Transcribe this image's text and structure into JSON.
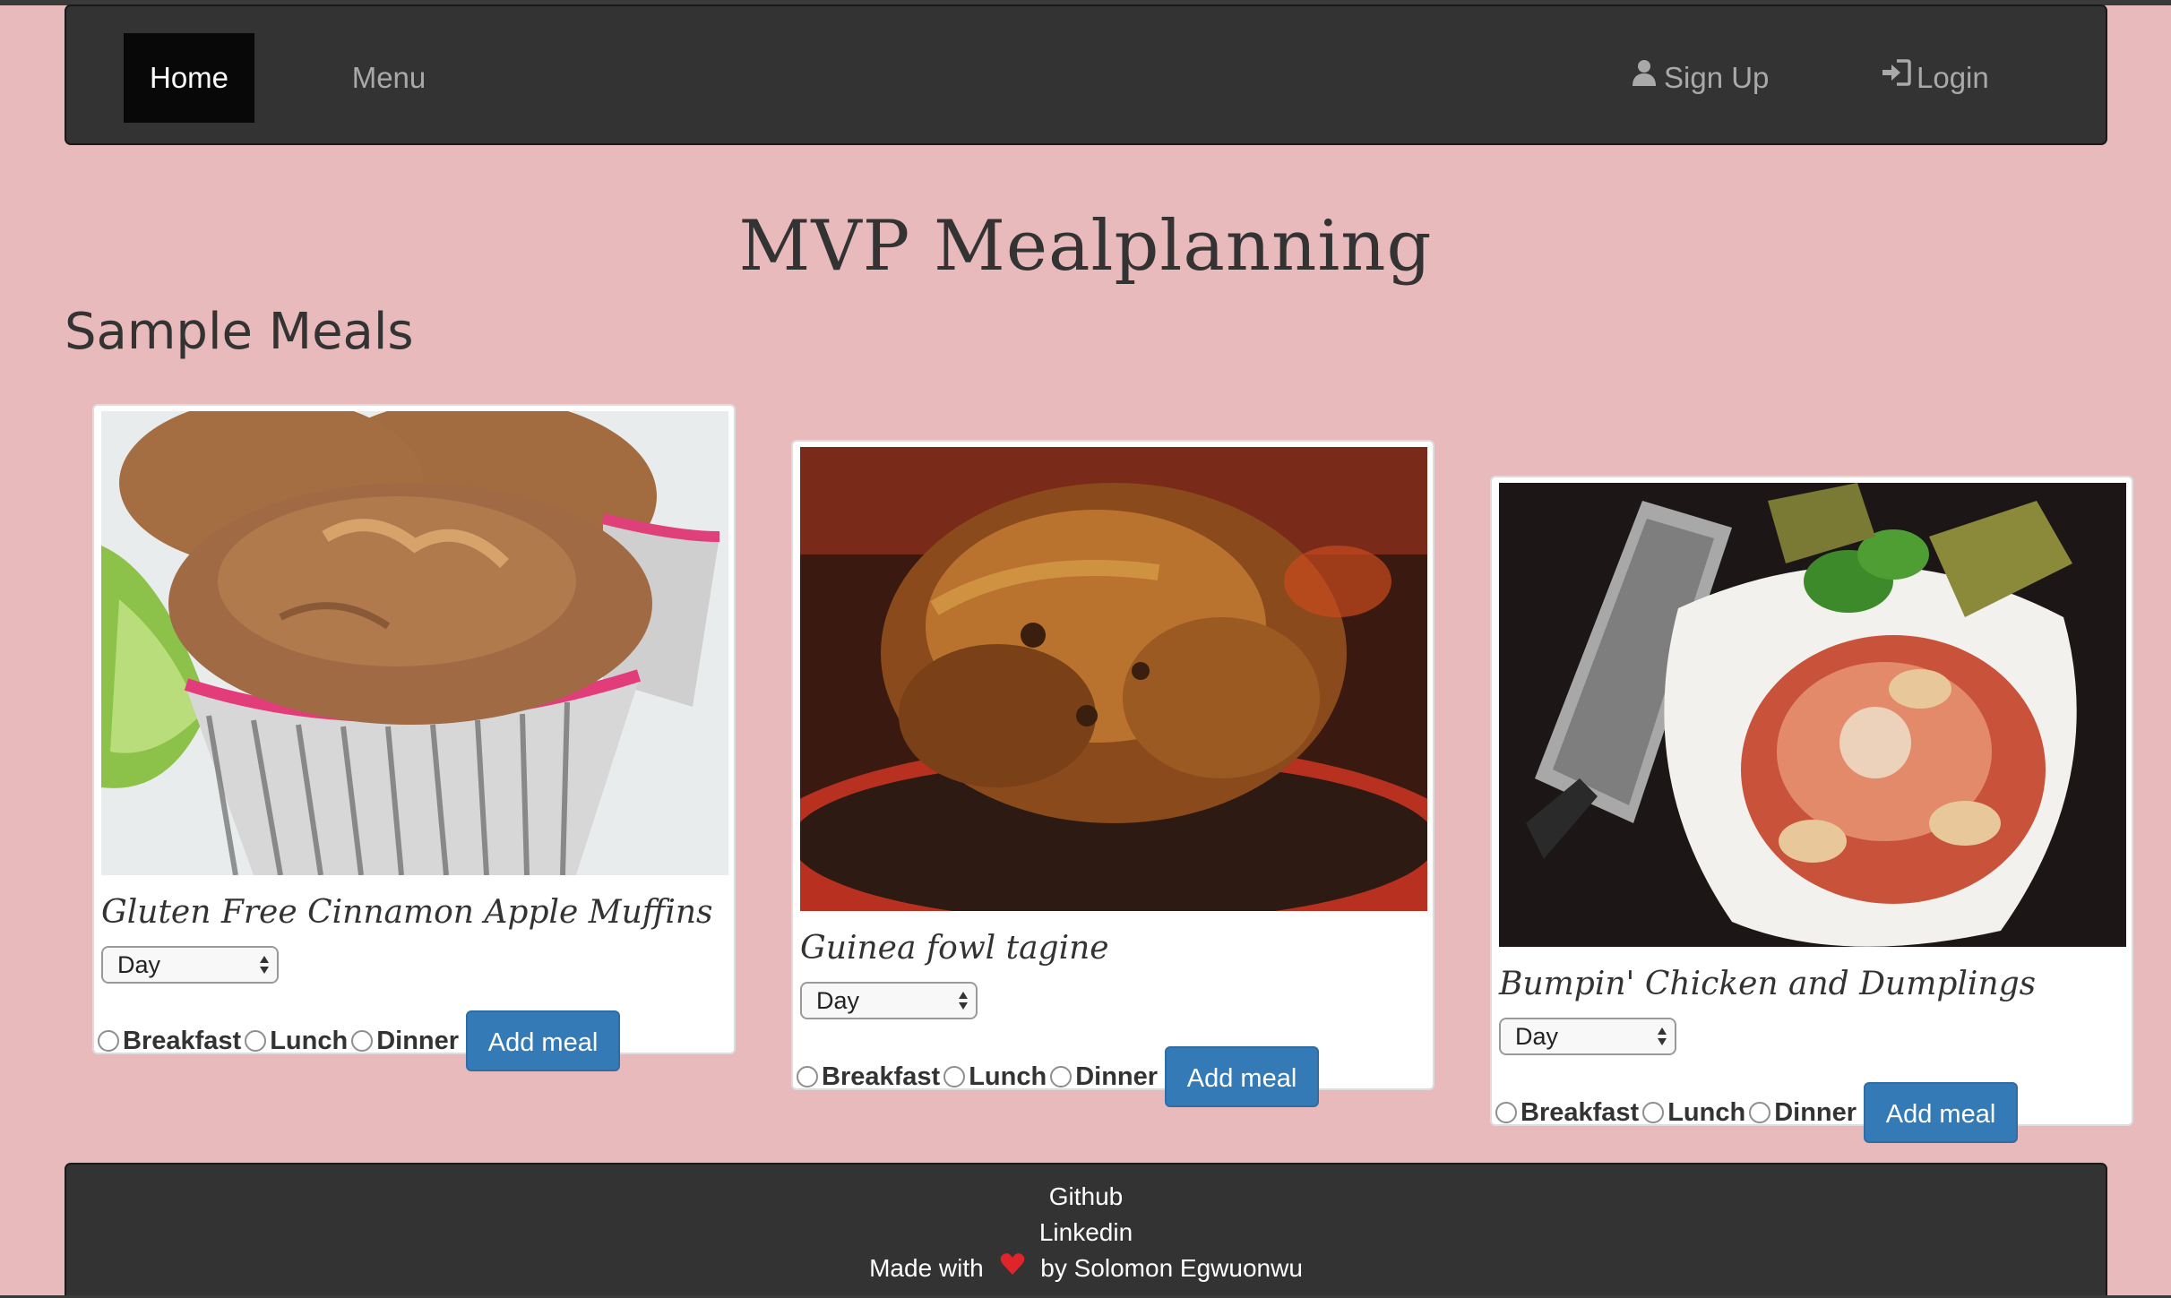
{
  "nav": {
    "home": "Home",
    "menu": "Menu",
    "signup": "Sign Up",
    "login": "Login"
  },
  "page": {
    "title": "MVP Mealplanning",
    "section_title": "Sample Meals"
  },
  "cards": [
    {
      "title": "Gluten Free Cinnamon Apple Muffins",
      "select_value": "Day",
      "options": [
        "Breakfast",
        "Lunch",
        "Dinner"
      ],
      "button": "Add meal",
      "image": "muffins-photo"
    },
    {
      "title": "Guinea fowl tagine",
      "select_value": "Day",
      "options": [
        "Breakfast",
        "Lunch",
        "Dinner"
      ],
      "button": "Add meal",
      "image": "roast-fowl-photo"
    },
    {
      "title": "Bumpin' Chicken and Dumplings",
      "select_value": "Day",
      "options": [
        "Breakfast",
        "Lunch",
        "Dinner"
      ],
      "button": "Add meal",
      "image": "pasta-dish-photo"
    }
  ],
  "footer": {
    "github": "Github",
    "linkedin": "Linkedin",
    "made_with_prefix": "Made with",
    "made_with_suffix": "by Solomon Egwuonwu"
  },
  "colors": {
    "background": "#e8babb",
    "navbar": "#333333",
    "button": "#337ab7",
    "heart": "#e0242c"
  }
}
